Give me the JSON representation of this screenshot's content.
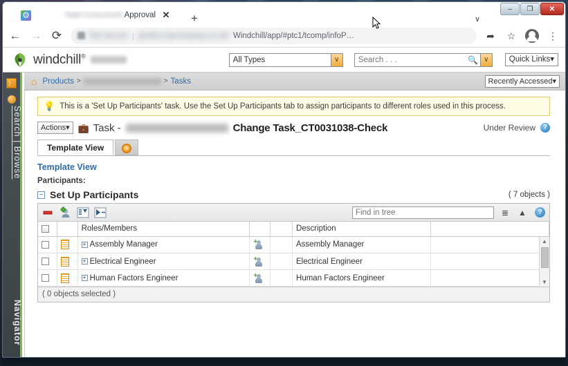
{
  "browser": {
    "tab": {
      "title_visible": "Approval",
      "title_blurred": true,
      "close_label": "✕",
      "favicon": "gear-favicon"
    },
    "new_tab_label": "+",
    "tab_list_label": "∨",
    "window_controls": {
      "minimize": "–",
      "maximize": "❐",
      "close": "✕"
    },
    "nav": {
      "back": "←",
      "forward": "→",
      "reload": "⟳"
    },
    "omnibox": {
      "security_text": "Not secure",
      "url_visible": "Windchill/app/#ptc1/tcomp/infoP…",
      "share_icon": "share-icon",
      "bookmark_icon": "star-icon",
      "profile_icon": "profile-icon",
      "menu_icon": "⋮"
    }
  },
  "masthead": {
    "product_name": "windchill",
    "trademark": "®",
    "types_select": {
      "value": "All Types",
      "caret": "∨"
    },
    "search": {
      "placeholder": "Search . . .",
      "value": "",
      "go_icon": "search-icon",
      "caret": "∨"
    },
    "quick_links": {
      "label": "Quick Links",
      "caret": "▾"
    }
  },
  "rail": {
    "toggle_icon": "expand-rail-icon",
    "toggle_glyph": "〉",
    "pin_icon": "pin-icon",
    "search_browse_label": "Search | Browse",
    "navigator_label": "Navigator"
  },
  "breadcrumb": {
    "home_icon": "home-icon",
    "items": [
      {
        "label": "Products",
        "blurred": false
      },
      {
        "label": "",
        "blurred": true
      },
      {
        "label": "Tasks",
        "blurred": false
      }
    ],
    "separator": ">",
    "recently_accessed": {
      "label": "Recently Accessed",
      "caret": "▾"
    }
  },
  "notice": {
    "icon": "lightbulb-icon",
    "text": "This is a 'Set Up Participants' task. Use the Set Up Participants tab to assign participants to different roles used in this process."
  },
  "title_row": {
    "actions_button": {
      "label": "Actions",
      "caret": "▾"
    },
    "task_icon": "task-icon",
    "task_prefix": "Task -",
    "task_name_blurred": true,
    "task_name": "Change Task_CT0031038-Check",
    "state": "Under Review",
    "help_icon": "help-icon",
    "help_glyph": "?"
  },
  "page_tabs": [
    {
      "label": "Template View",
      "active": true,
      "name": "tab-template-view"
    },
    {
      "label": "",
      "active": false,
      "name": "tab-add-icon",
      "icon": "add-circle-icon",
      "icon_glyph": "+"
    }
  ],
  "content": {
    "subtitle": "Template View",
    "participants_label": "Participants:",
    "section": {
      "collapse_glyph": "−",
      "title": "Set Up Participants",
      "object_count": "( 7 objects )"
    }
  },
  "table": {
    "toolbar": {
      "remove_icon": "remove-participant-icon",
      "add_icon": "add-participant-icon",
      "collapse_all_icon": "collapse-all-icon",
      "expand_all_icon": "expand-all-icon",
      "find_placeholder": "Find in tree",
      "find_value": "",
      "filter_icon": "filter-icon",
      "sort_icon": "sort-icon",
      "help_icon": "table-help-icon",
      "help_glyph": "?"
    },
    "columns": [
      "",
      "",
      "Roles/Members",
      "",
      "",
      "Description",
      "",
      ""
    ],
    "rows": [
      {
        "role": "Assembly Manager",
        "description": "Assembly Manager",
        "expand_glyph": "+",
        "checked": false
      },
      {
        "role": "Electrical Engineer",
        "description": "Electrical Engineer",
        "expand_glyph": "+",
        "checked": false
      },
      {
        "role": "Human Factors Engineer",
        "description": "Human Factors Engineer",
        "expand_glyph": "+",
        "checked": false
      }
    ],
    "scroll": {
      "up_glyph": "▲",
      "down_glyph": "▼"
    },
    "status": "( 0 objects selected )"
  }
}
